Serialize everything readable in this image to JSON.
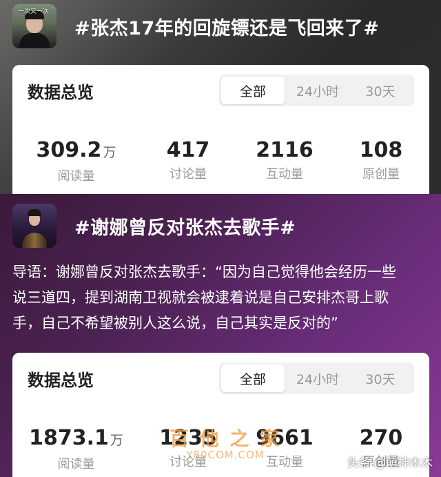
{
  "topic1": {
    "avatar_caption": "一次又一次",
    "title": "#张杰17年的回旋镖还是飞回来了#",
    "card": {
      "title": "数据总览",
      "tabs": [
        "全部",
        "24小时",
        "30天"
      ],
      "active_tab": "全部",
      "stats": [
        {
          "value": "309.2",
          "unit": "万",
          "label": "阅读量"
        },
        {
          "value": "417",
          "unit": "",
          "label": "讨论量"
        },
        {
          "value": "2116",
          "unit": "",
          "label": "互动量"
        },
        {
          "value": "108",
          "unit": "",
          "label": "原创量"
        }
      ]
    }
  },
  "topic2": {
    "title": "#谢娜曾反对张杰去歌手#",
    "intro_lines": [
      "导语：谢娜曾反对张杰去歌手：“因为自己觉得他会经历一些",
      "说三道四，提到湖南卫视就会被逮着说是自己安排杰哥上歌",
      "手，自己不希望被别人这么说，自己其实是反对的”"
    ],
    "card": {
      "title": "数据总览",
      "tabs": [
        "全部",
        "24小时",
        "30天"
      ],
      "active_tab": "全部",
      "stats": [
        {
          "value": "1873.1",
          "unit": "万",
          "label": "阅读量"
        },
        {
          "value": "1235",
          "unit": "",
          "label": "讨论量"
        },
        {
          "value": "9661",
          "unit": "",
          "label": "互动量"
        },
        {
          "value": "270",
          "unit": "",
          "label": "原创量"
        }
      ]
    }
  },
  "watermark": {
    "main": "百 他 之 家",
    "sub": "Y80COM.COM"
  },
  "credit": "头条 @萌神木木"
}
